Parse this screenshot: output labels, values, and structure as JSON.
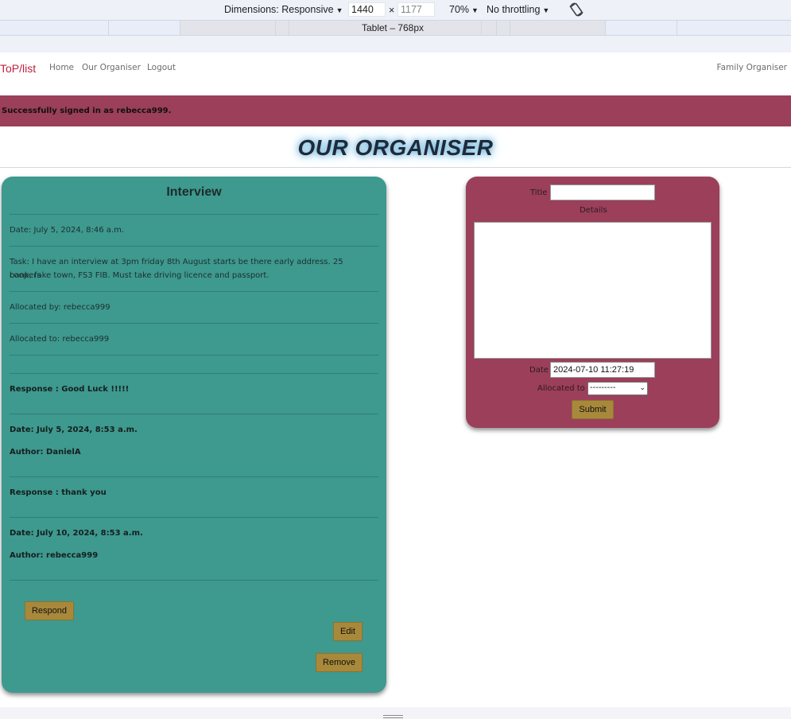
{
  "devtools": {
    "dimensions_label": "Dimensions: Responsive",
    "width_value": "1440",
    "times": "×",
    "height_value": "1177",
    "zoom": "70%",
    "throttling": "No throttling",
    "device_label": "Tablet – 768px"
  },
  "nav": {
    "brand": "ToP/list",
    "links": [
      "Home",
      "Our Organiser",
      "Logout"
    ],
    "right": "Family Organiser"
  },
  "alert": {
    "message": "Successfully signed in as rebecca999."
  },
  "page": {
    "title": "OUR ORGANISER"
  },
  "task": {
    "title": "Interview",
    "date": "Date: July 5, 2024, 8:46 a.m.",
    "task_line1": "Task: I have an interview at 3pm friday 8th August starts be there early address. 25 coopers",
    "task_line2": "bank, fake town, FS3 FIB. Must take driving licence and passport.",
    "allocated_by": "Allocated by: rebecca999",
    "allocated_to": "Allocated to: rebecca999",
    "responses": [
      {
        "response": "Response : Good Luck !!!!!",
        "date": "Date: July 5, 2024, 8:53 a.m.",
        "author": "Author: DanielA"
      },
      {
        "response": "Response : thank you",
        "date": "Date: July 10, 2024, 8:53 a.m.",
        "author": "Author: rebecca999"
      }
    ],
    "buttons": {
      "respond": "Respond",
      "edit": "Edit",
      "remove": "Remove"
    }
  },
  "form": {
    "title_label": "Title",
    "title_value": "",
    "details_label": "Details",
    "date_label": "Date",
    "date_value": "2024-07-10 11:27:19",
    "allocated_label": "Allocated to",
    "allocated_value": "---------",
    "submit": "Submit"
  }
}
